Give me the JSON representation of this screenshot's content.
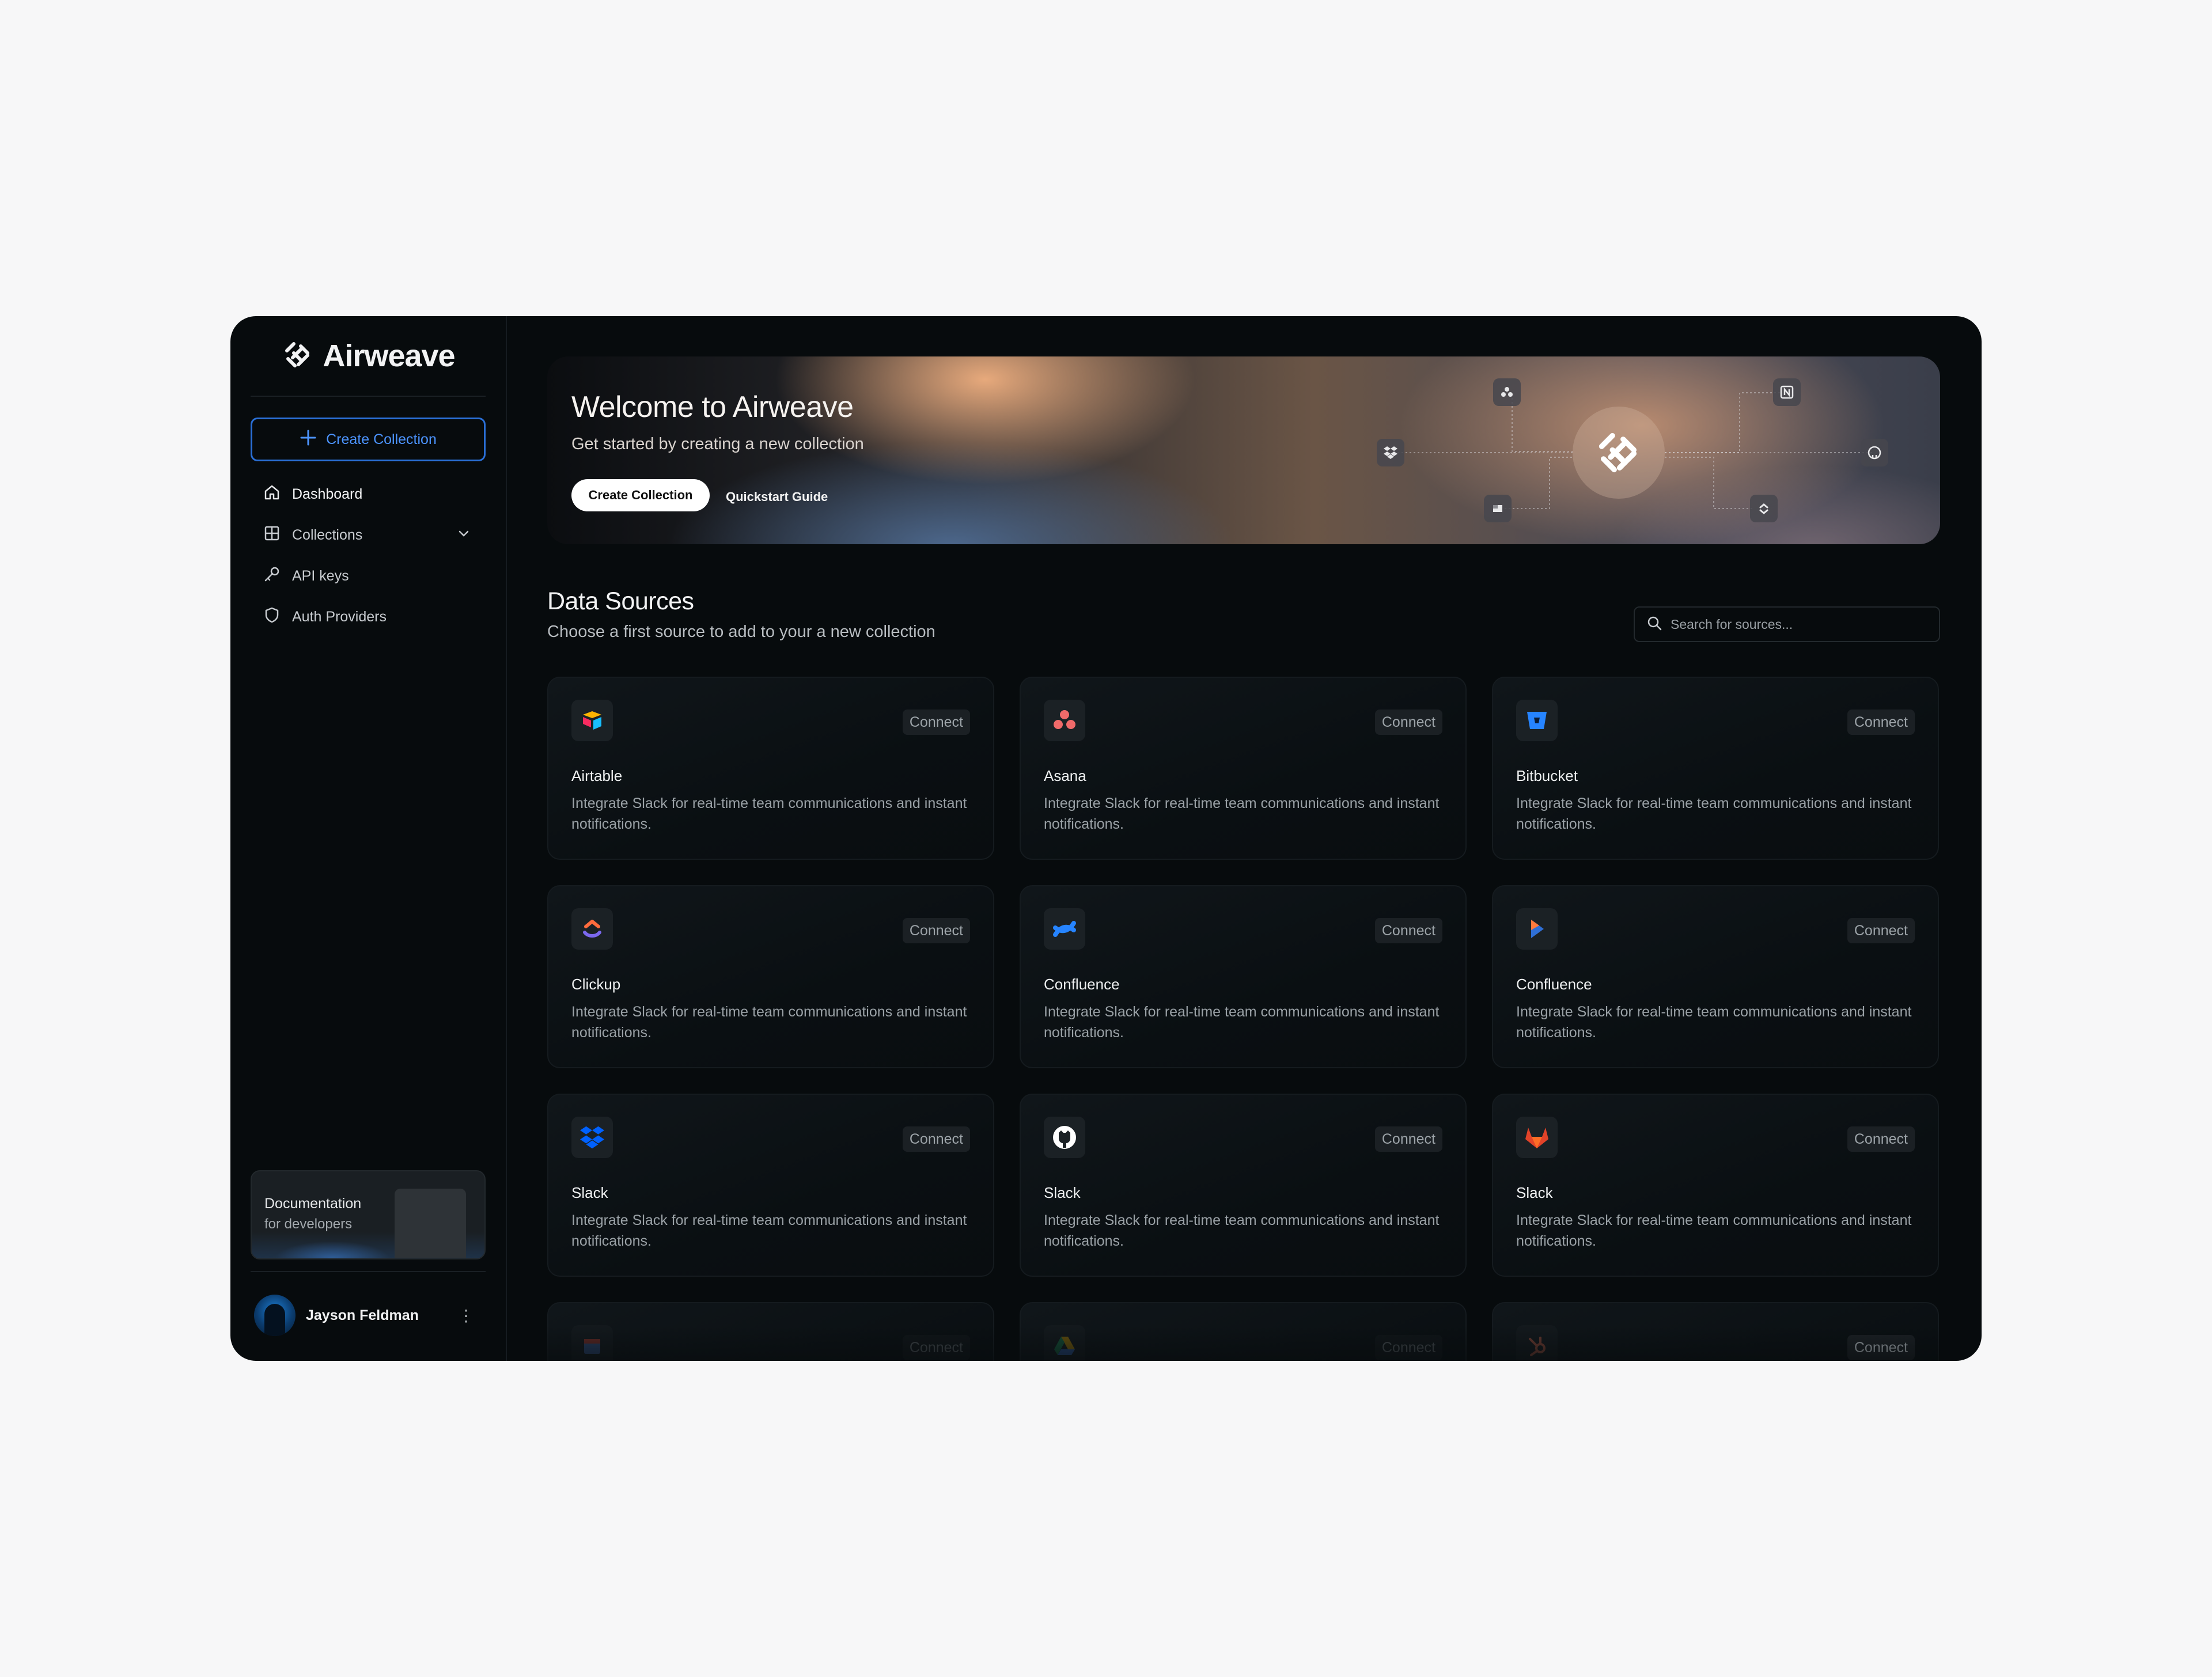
{
  "app": {
    "name": "Airweave"
  },
  "sidebar": {
    "create_button": "Create Collection",
    "items": [
      {
        "label": "Dashboard",
        "icon": "home-icon",
        "active": true
      },
      {
        "label": "Collections",
        "icon": "grid-icon",
        "expandable": true
      },
      {
        "label": "API keys",
        "icon": "key-icon"
      },
      {
        "label": "Auth Providers",
        "icon": "shield-icon"
      }
    ],
    "doc_card": {
      "title": "Documentation",
      "subtitle": "for developers"
    },
    "user": {
      "name": "Jayson Feldman"
    }
  },
  "hero": {
    "title": "Welcome to Airweave",
    "subtitle": "Get started by creating a new collection",
    "primary_button": "Create Collection",
    "secondary_link": "Quickstart Guide",
    "diagram_nodes": [
      "asana-icon",
      "dropbox-icon",
      "airtable-icon",
      "notion-icon",
      "github-icon",
      "clickup-icon"
    ]
  },
  "data_sources": {
    "title": "Data Sources",
    "subtitle": "Choose a first source to add to your a new collection",
    "search_placeholder": "Search for sources...",
    "connect_label": "Connect",
    "cards": [
      {
        "name": "Airtable",
        "icon": "airtable-icon",
        "description": "Integrate Slack for real-time team communications and instant notifications."
      },
      {
        "name": "Asana",
        "icon": "asana-icon",
        "description": "Integrate Slack for real-time team communications and instant notifications."
      },
      {
        "name": "Bitbucket",
        "icon": "bitbucket-icon",
        "description": "Integrate Slack for real-time team communications and instant notifications."
      },
      {
        "name": "Clickup",
        "icon": "clickup-icon",
        "description": "Integrate Slack for real-time team communications and instant notifications."
      },
      {
        "name": "Confluence",
        "icon": "confluence-icon",
        "description": "Integrate Slack for real-time team communications and instant notifications."
      },
      {
        "name": "Confluence",
        "icon": "play-icon",
        "description": "Integrate Slack for real-time team communications and instant notifications."
      },
      {
        "name": "Slack",
        "icon": "dropbox-icon",
        "description": "Integrate Slack for real-time team communications and instant notifications."
      },
      {
        "name": "Slack",
        "icon": "github-icon",
        "description": "Integrate Slack for real-time team communications and instant notifications."
      },
      {
        "name": "Slack",
        "icon": "gitlab-icon",
        "description": "Integrate Slack for real-time team communications and instant notifications."
      }
    ],
    "partial_row_connect": [
      "Connect",
      "Connect",
      "Connect"
    ]
  },
  "colors": {
    "accent": "#2a6fd6",
    "background": "#070b0d",
    "page": "#f7f7f8"
  }
}
